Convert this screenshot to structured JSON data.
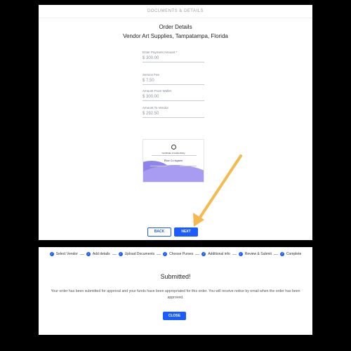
{
  "top": {
    "section_label": "DOCUMENTS & DETAILS",
    "title": "Order Details",
    "subtitle": "Vendor Art Supplies, Tampatampa, Florida",
    "fields": [
      {
        "label": "Enter Payment Amount *",
        "value": "$  300.00"
      },
      {
        "label": "Service Fee",
        "value": "$  7.50"
      },
      {
        "label": "Amount From Wallet",
        "value": "$  300.00"
      },
      {
        "label": "Amount To Vendor",
        "value": "$  292.50"
      }
    ],
    "certificate": {
      "title": "Certificate of Authenticity",
      "signature": "Fine Co.signee"
    },
    "back_label": "BACK",
    "next_label": "NEXT",
    "arrow_color": "#f6b94f",
    "accent": "#1a5cff"
  },
  "bottom": {
    "steps": [
      {
        "label": "Select Vendor",
        "done": true
      },
      {
        "label": "Add details",
        "done": true
      },
      {
        "label": "Upload Documents",
        "done": true
      },
      {
        "label": "Choose Purses",
        "done": true
      },
      {
        "label": "Additional info",
        "done": true
      },
      {
        "label": "Review & Submit",
        "done": true
      },
      {
        "label": "Complete",
        "done": false,
        "number": "7"
      }
    ],
    "heading": "Submitted!",
    "message": "Your order has been submitted for approval and your funds have been appropriated for this order. You will receive notice by email when the order has been approved.",
    "close_label": "CLOSE"
  }
}
